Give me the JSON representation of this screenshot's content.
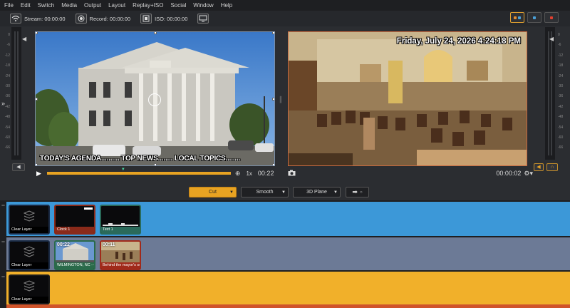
{
  "menu": [
    "File",
    "Edit",
    "Switch",
    "Media",
    "Output",
    "Layout",
    "Replay+ISO",
    "Social",
    "Window",
    "Help"
  ],
  "toolbar": {
    "stream_label": "Stream: 00:00:00",
    "record_label": "Record: 00:00:00",
    "iso_label": "ISO: 00:00:00"
  },
  "meter_ticks": [
    "0",
    "-6",
    "-12",
    "-18",
    "-24",
    "-30",
    "-36",
    "-42",
    "-48",
    "-54",
    "-60",
    "-66"
  ],
  "preview": {
    "ticker_text": "TODAY'S AGENDA.......... TOP NEWS........ LOCAL TOPICS........",
    "speed": "1x",
    "time": "00:22"
  },
  "program": {
    "clock_text": "Friday, July 24, 2026  4:24:18 PM",
    "time": "00:00:02"
  },
  "transitions": {
    "cut": "Cut",
    "smooth": "Smooth",
    "plane": "3D Plane"
  },
  "layers": [
    {
      "color": "#3c98d8",
      "tiles": [
        {
          "label": "Clear Layer",
          "type": "clear",
          "label_color": "#1a1a1a"
        },
        {
          "label": "Clock 1",
          "type": "clock",
          "label_color": "#8a2a1a"
        },
        {
          "label": "Text 1",
          "type": "text",
          "label_color": "#2a6a5a"
        }
      ]
    },
    {
      "color": "#6c7a96",
      "tiles": [
        {
          "label": "Clear Layer",
          "type": "clear",
          "label_color": "#1a1a1a"
        },
        {
          "label": "WILMINGTON, NC - C",
          "type": "building",
          "timer": "00:22",
          "label_color": "#2a6a4a"
        },
        {
          "label": "Behind the mayor's se",
          "type": "room",
          "timer": "00:11",
          "label_color": "#a02a1a"
        }
      ]
    },
    {
      "color": "#f1b02a",
      "tiles": [
        {
          "label": "Clear Layer",
          "type": "clear",
          "label_color": "#1a1a1a"
        }
      ]
    }
  ]
}
